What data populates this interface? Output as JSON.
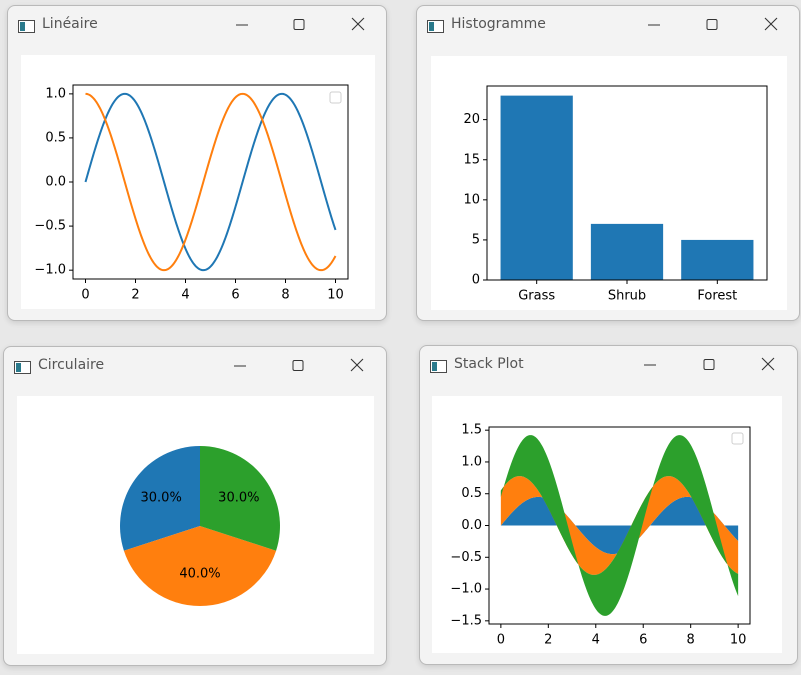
{
  "windows": {
    "lineaire": {
      "title": "Linéaire"
    },
    "histogramme": {
      "title": "Histogramme"
    },
    "circulaire": {
      "title": "Circulaire"
    },
    "stack": {
      "title": "Stack Plot"
    }
  },
  "colors": {
    "blue": "#1f77b4",
    "orange": "#ff7f0e",
    "green": "#2ca02c"
  },
  "chart_data": [
    {
      "type": "line",
      "window": "Linéaire",
      "x_range": [
        0,
        10
      ],
      "xlim": [
        -0.5,
        10.5
      ],
      "ylim": [
        -1.1,
        1.1
      ],
      "xticks": [
        "0",
        "2",
        "4",
        "6",
        "8",
        "10"
      ],
      "yticks": [
        "1.0",
        "0.5",
        "0.0",
        "−0.5",
        "−1.0"
      ],
      "series": [
        {
          "function": "sin(x)",
          "color": "#1f77b4"
        },
        {
          "function": "cos(x)",
          "color": "#ff7f0e"
        }
      ],
      "legend": "top-right (empty)"
    },
    {
      "type": "bar",
      "window": "Histogramme",
      "categories": [
        "Grass",
        "Shrub",
        "Forest"
      ],
      "values": [
        23,
        7,
        5
      ],
      "color": "#1f77b4",
      "yticks": [
        "0",
        "5",
        "10",
        "15",
        "20"
      ],
      "ylim": [
        0,
        24.2
      ]
    },
    {
      "type": "pie",
      "window": "Circulaire",
      "slices": [
        {
          "value": 30,
          "label": "30.0%",
          "color": "#1f77b4"
        },
        {
          "value": 40,
          "label": "40.0%",
          "color": "#ff7f0e"
        },
        {
          "value": 30,
          "label": "30.0%",
          "color": "#2ca02c"
        }
      ]
    },
    {
      "type": "area",
      "stacked": true,
      "window": "Stack Plot",
      "x_range": [
        0,
        10
      ],
      "xlim": [
        -0.5,
        10.5
      ],
      "ylim": [
        -1.55,
        1.55
      ],
      "xticks": [
        "0",
        "2",
        "4",
        "6",
        "8",
        "10"
      ],
      "yticks": [
        "1.5",
        "1.0",
        "0.5",
        "0.0",
        "−0.5",
        "−1.0",
        "−1.5"
      ],
      "series": [
        {
          "function": "0.45*sin(x)",
          "color": "#1f77b4"
        },
        {
          "function": "0.55*sin(x) - 0.45*sin(x) + 0.55*cos(x)",
          "color": "#ff7f0e"
        },
        {
          "function": "0.8*sin(x) + 0.45*cos(x) - 0.55*cos(x)",
          "color": "#2ca02c"
        }
      ],
      "legend": "top-right (empty)"
    }
  ]
}
